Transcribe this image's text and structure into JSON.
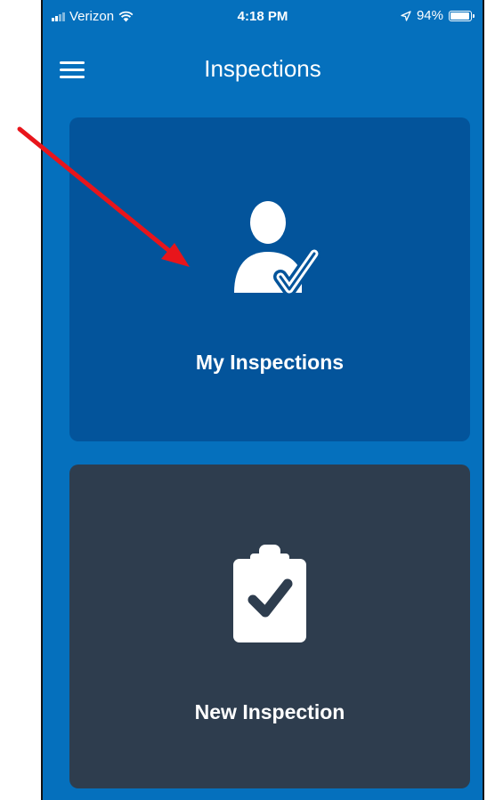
{
  "status_bar": {
    "carrier": "Verizon",
    "time": "4:18 PM",
    "battery_percent": "94%",
    "battery_level": 0.94,
    "icons": [
      "signal-icon",
      "wifi-icon",
      "location-arrow-icon",
      "battery-icon"
    ]
  },
  "nav": {
    "title": "Inspections",
    "menu_icon": "hamburger-menu-icon"
  },
  "tiles": [
    {
      "label": "My Inspections",
      "icon": "user-check-icon",
      "color": "#03549b"
    },
    {
      "label": "New Inspection",
      "icon": "clipboard-check-icon",
      "color": "#2e3d4e"
    }
  ],
  "colors": {
    "app_background": "#0570bd",
    "annotation_arrow": "#e8151b"
  }
}
